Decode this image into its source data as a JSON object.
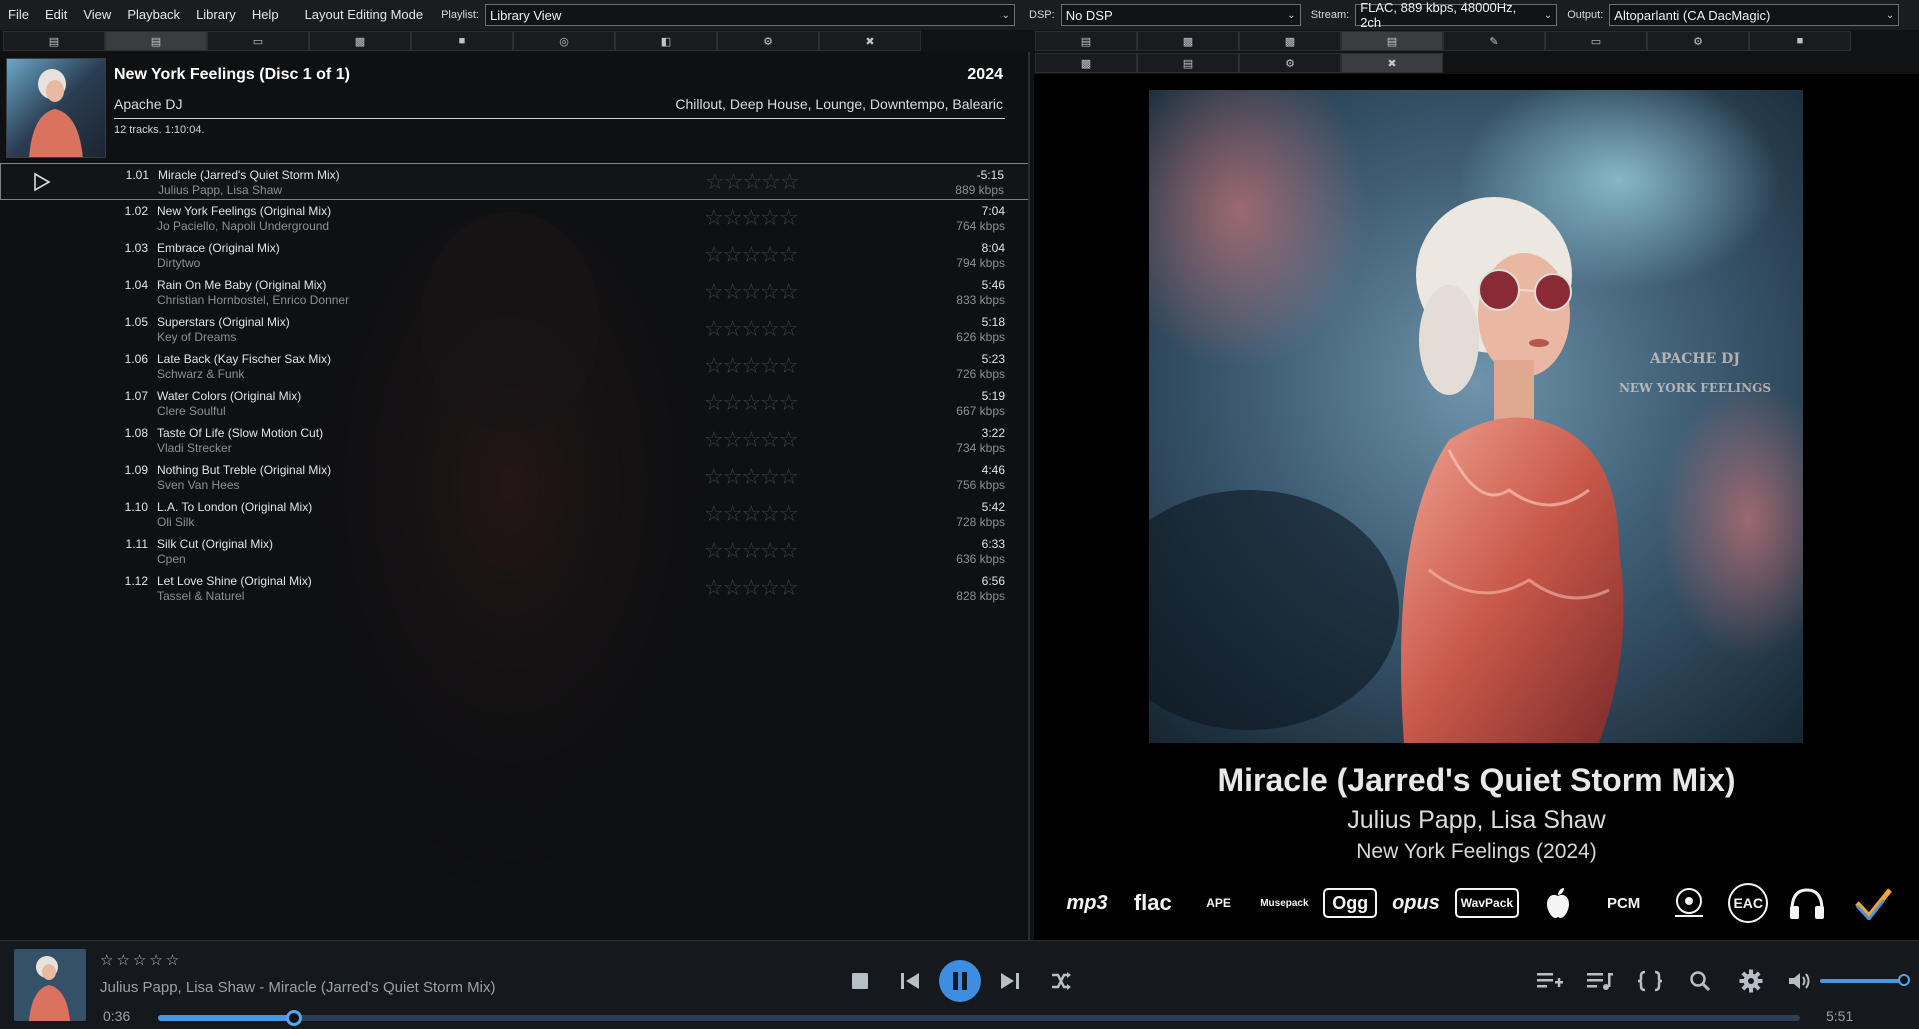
{
  "menu": {
    "items": [
      "File",
      "Edit",
      "View",
      "Playback",
      "Library",
      "Help",
      "Layout Editing Mode"
    ],
    "playlist_label": "Playlist:",
    "playlist_value": "Library View",
    "dsp_label": "DSP:",
    "dsp_value": "No DSP",
    "stream_label": "Stream:",
    "stream_value": "FLAC, 889 kbps, 48000Hz, 2ch",
    "output_label": "Output:",
    "output_value": "Altoparlanti (CA DacMagic)"
  },
  "album": {
    "title": "New York Feelings (Disc 1 of 1)",
    "year": "2024",
    "artist": "Apache DJ",
    "genres": "Chillout, Deep House, Lounge, Downtempo, Balearic",
    "summary": "12 tracks. 1:10:04."
  },
  "tracks": [
    {
      "num": "1.01",
      "title": "Miracle (Jarred's Quiet Storm Mix)",
      "artist": "Julius Papp, Lisa Shaw",
      "duration": "-5:15",
      "bitrate": "889 kbps",
      "playing": true
    },
    {
      "num": "1.02",
      "title": "New York Feelings (Original Mix)",
      "artist": "Jo Paciello, Napoli Underground",
      "duration": "7:04",
      "bitrate": "764 kbps"
    },
    {
      "num": "1.03",
      "title": "Embrace (Original Mix)",
      "artist": "Dirtytwo",
      "duration": "8:04",
      "bitrate": "794 kbps"
    },
    {
      "num": "1.04",
      "title": "Rain On Me Baby (Original Mix)",
      "artist": "Christian Hornbostel, Enrico Donner",
      "duration": "5:46",
      "bitrate": "833 kbps"
    },
    {
      "num": "1.05",
      "title": "Superstars (Original Mix)",
      "artist": "Key of Dreams",
      "duration": "5:18",
      "bitrate": "626 kbps"
    },
    {
      "num": "1.06",
      "title": "Late Back (Kay Fischer Sax Mix)",
      "artist": "Schwarz & Funk",
      "duration": "5:23",
      "bitrate": "726 kbps"
    },
    {
      "num": "1.07",
      "title": "Water Colors (Original Mix)",
      "artist": "Clere Soulful",
      "duration": "5:19",
      "bitrate": "667 kbps"
    },
    {
      "num": "1.08",
      "title": "Taste Of Life (Slow Motion Cut)",
      "artist": "Vladi Strecker",
      "duration": "3:22",
      "bitrate": "734 kbps"
    },
    {
      "num": "1.09",
      "title": "Nothing But Treble (Original Mix)",
      "artist": "Sven Van Hees",
      "duration": "4:46",
      "bitrate": "756 kbps"
    },
    {
      "num": "1.10",
      "title": "L.A. To London (Original Mix)",
      "artist": "Oli Silk",
      "duration": "5:42",
      "bitrate": "728 kbps"
    },
    {
      "num": "1.11",
      "title": "Silk Cut (Original Mix)",
      "artist": "Cpen",
      "duration": "6:33",
      "bitrate": "636 kbps"
    },
    {
      "num": "1.12",
      "title": "Let Love Shine (Original Mix)",
      "artist": "Tassel & Naturel",
      "duration": "6:56",
      "bitrate": "828 kbps"
    }
  ],
  "now_playing": {
    "title": "Miracle (Jarred's Quiet Storm Mix)",
    "artist": "Julius Papp, Lisa Shaw",
    "album": "New York Feelings (2024)",
    "cover_text_line1": "APACHE DJ",
    "cover_text_line2": "NEW YORK FEELINGS"
  },
  "format_logos": [
    "mp3",
    "flac",
    "APE",
    "Musepack",
    "Ogg",
    "opus",
    "WavPack",
    "apple-icon",
    "PCM",
    "super-audio-cd-icon",
    "EAC",
    "headphones-icon",
    "checkmark-icon"
  ],
  "format_logo_labels": {
    "mp3": "mp3",
    "flac": "flac",
    "ape": "APE",
    "musepack": "Musepack",
    "ogg": "Ogg",
    "opus": "opus",
    "wavpack": "WavPack",
    "pcm": "PCM",
    "eac": "EAC"
  },
  "bottom": {
    "track_text": "Julius Papp, Lisa Shaw - Miracle (Jarred's Quiet Storm Mix)",
    "elapsed": "0:36",
    "total": "5:51",
    "progress_fraction": 0.083,
    "volume_fraction": 1.0,
    "rating_stars": "☆☆☆☆☆"
  },
  "colors": {
    "accent": "#4e95dc",
    "background": "#111214",
    "panel_right": "#000000"
  },
  "left_tab_icons": [
    "doc-icon",
    "list-icon",
    "book-icon",
    "card-icon",
    "folder-icon",
    "disc-icon",
    "copy-icon",
    "gear-icon",
    "tools-icon"
  ],
  "right_tab_icons": [
    "doc-icon",
    "image-icon",
    "photo-icon",
    "list-icon",
    "edit-icon",
    "card-icon",
    "settings-icon",
    "folder-icon",
    "image-icon",
    "archive-icon",
    "gear-icon",
    "tools-icon"
  ]
}
